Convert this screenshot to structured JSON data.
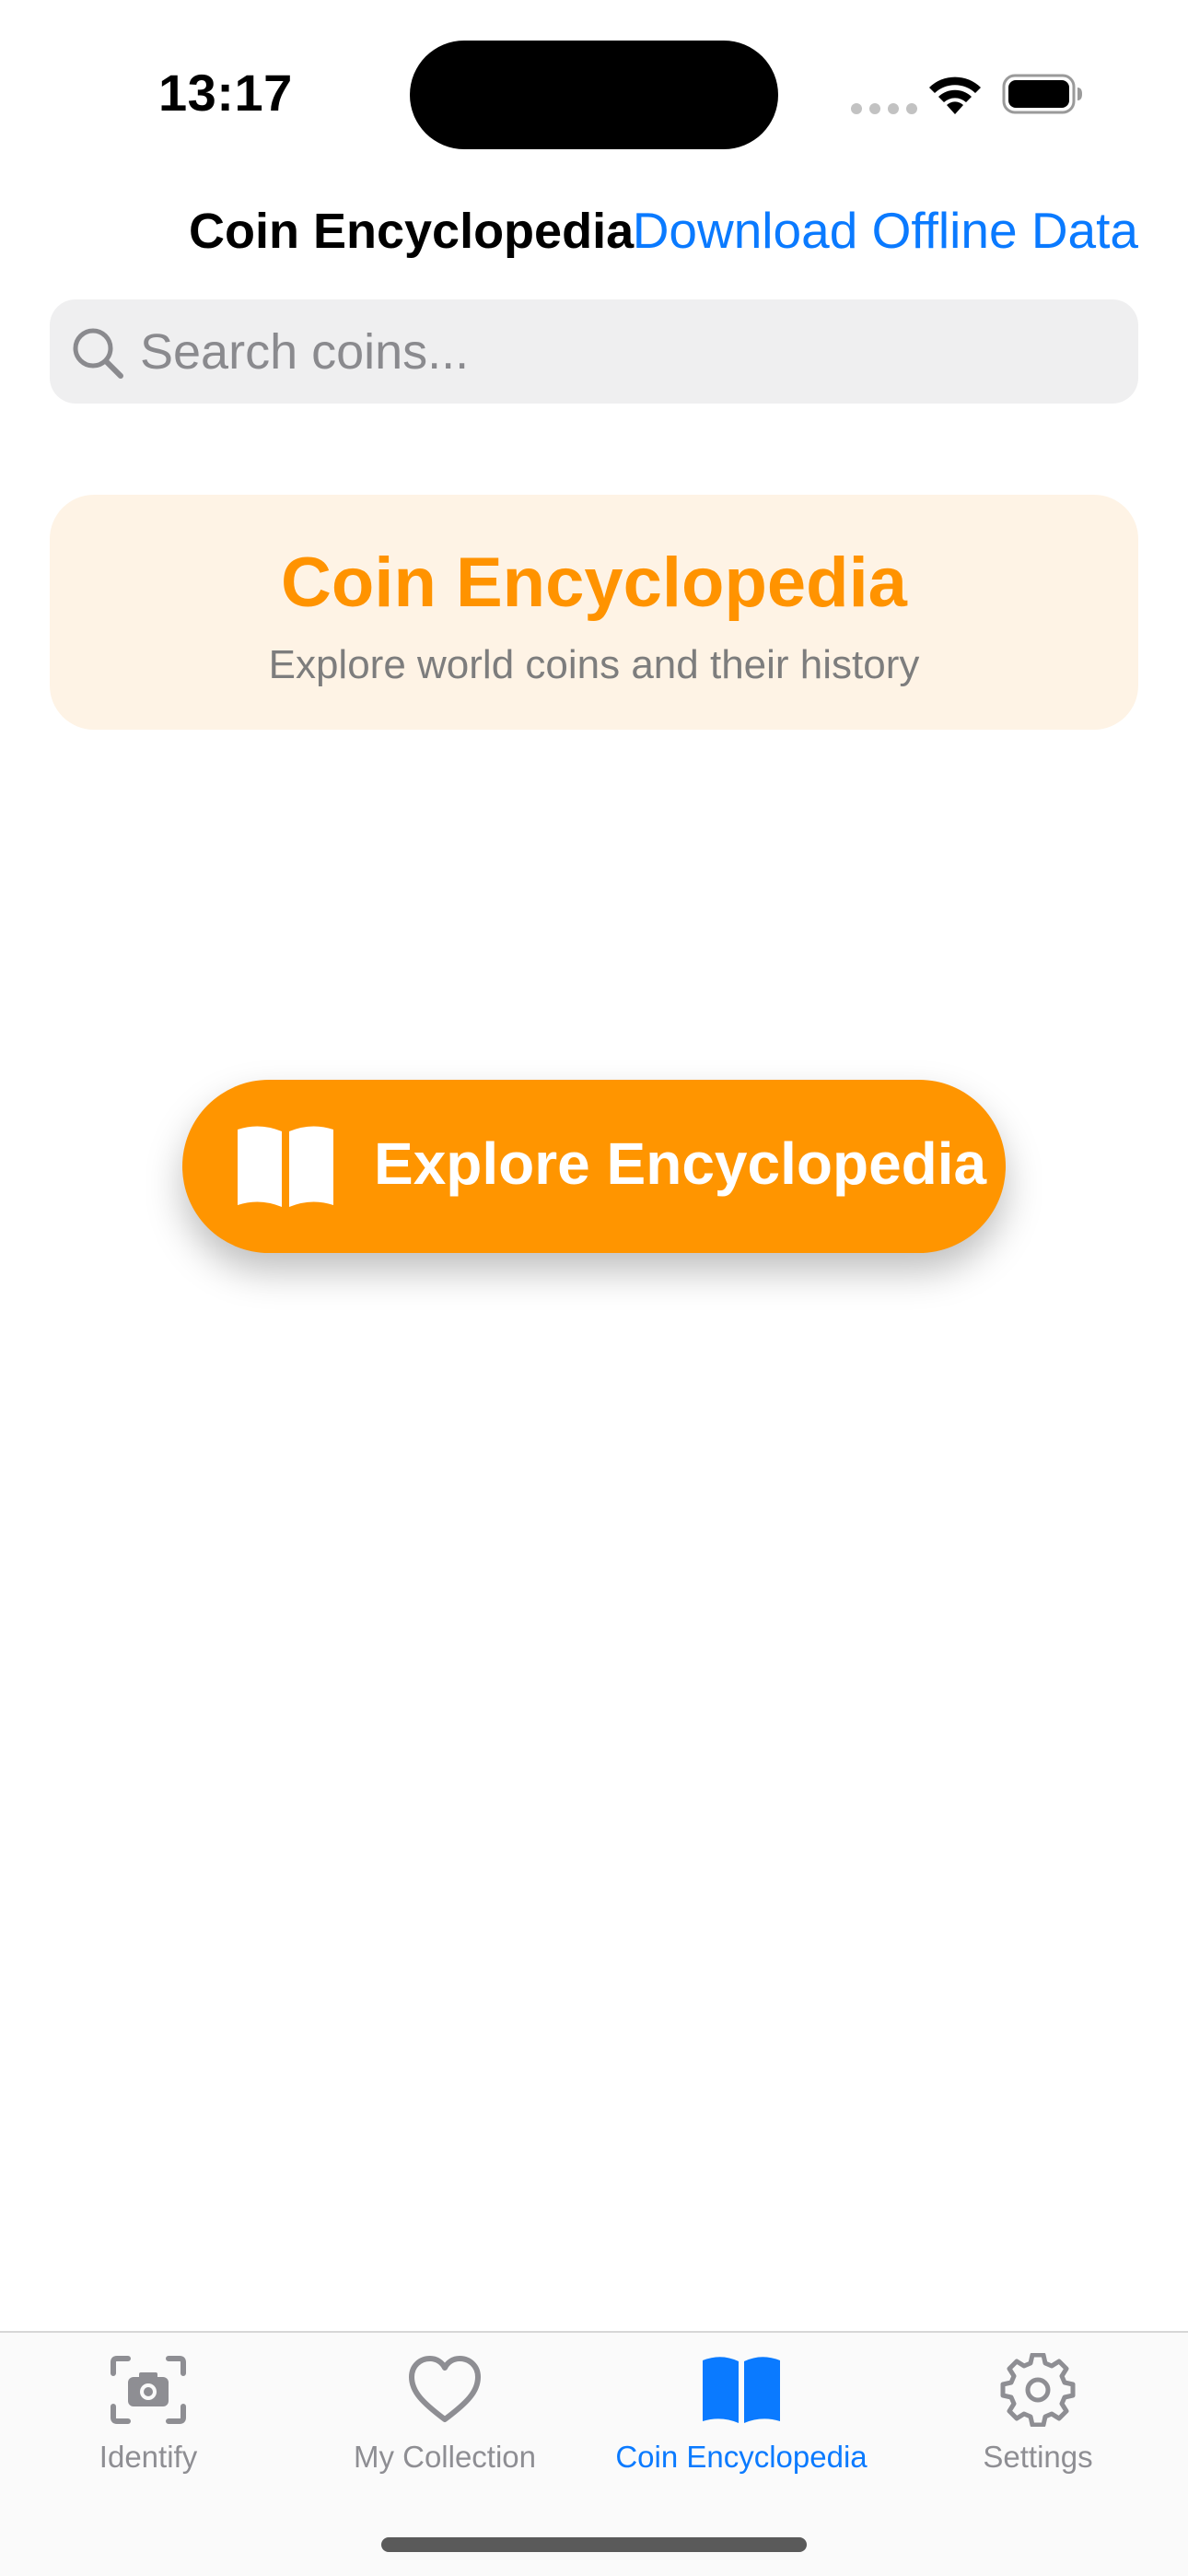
{
  "status_bar": {
    "time": "13:17"
  },
  "nav": {
    "title": "Coin Encyclopedia",
    "action_label": "Download Offline Data"
  },
  "search": {
    "placeholder": "Search coins...",
    "value": ""
  },
  "header_card": {
    "title": "Coin Encyclopedia",
    "subtitle": "Explore world coins and their history"
  },
  "explore_button": {
    "label": "Explore Encyclopedia",
    "icon": "book-icon"
  },
  "tab_bar": {
    "active_index": 2,
    "items": [
      {
        "label": "Identify",
        "icon": "camera-icon"
      },
      {
        "label": "My Collection",
        "icon": "heart-icon"
      },
      {
        "label": "Coin Encyclopedia",
        "icon": "book-icon"
      },
      {
        "label": "Settings",
        "icon": "gear-icon"
      }
    ]
  },
  "colors": {
    "accent_orange": "#ff9500",
    "link_blue": "#0a7aff",
    "card_background": "#fef3e5",
    "search_background": "#efeff0",
    "inactive_tab": "#8e8e93"
  }
}
